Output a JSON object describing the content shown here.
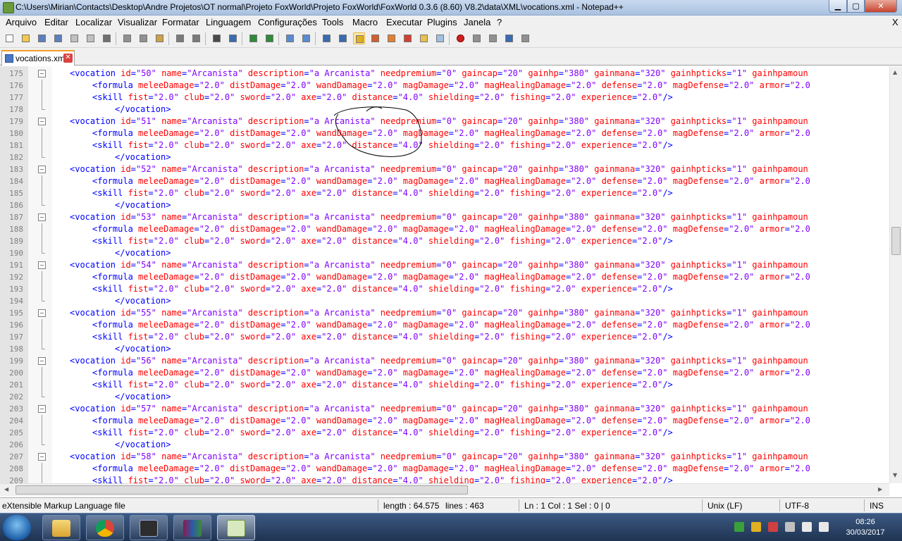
{
  "window": {
    "title": "C:\\Users\\Mirian\\Contacts\\Desktop\\Andre Projetos\\OT normal\\Projeto FoxWorld\\Projeto FoxWorld\\FoxWorld 0.3.6 (8.60) V8.2\\data\\XML\\vocations.xml - Notepad++",
    "min_label": "▁",
    "max_label": "▢",
    "close_label": "✕"
  },
  "menu": {
    "items": [
      "Arquivo",
      "Editar",
      "Localizar",
      "Visualizar",
      "Formatar",
      "Linguagem",
      "Configurações",
      "Tools",
      "Macro",
      "Executar",
      "Plugins",
      "Janela",
      "?"
    ],
    "close_doc": "X"
  },
  "toolbar": {
    "icons": [
      "new-file-icon",
      "open-file-icon",
      "save-icon",
      "save-all-icon",
      "close-icon",
      "close-all-icon",
      "print-icon",
      "cut-icon",
      "copy-icon",
      "paste-icon",
      "undo-icon",
      "redo-icon",
      "find-icon",
      "replace-icon",
      "zoom-in-icon",
      "zoom-out-icon",
      "sync-vertical-icon",
      "sync-horizontal-icon",
      "word-wrap-icon",
      "show-all-chars-icon",
      "indent-guide-icon",
      "user-language-icon",
      "document-map-icon",
      "function-list-icon",
      "folder-workspace-icon",
      "monitoring-icon",
      "record-macro-icon",
      "stop-macro-icon",
      "play-macro-icon",
      "run-macro-multiple-icon",
      "save-macro-icon"
    ]
  },
  "tab": {
    "label": "vocations.xml",
    "close": "✕"
  },
  "editor": {
    "lines": [
      {
        "n": "175",
        "kind": "vocation",
        "id": "50"
      },
      {
        "n": "176",
        "kind": "formula"
      },
      {
        "n": "177",
        "kind": "skill"
      },
      {
        "n": "178",
        "kind": "end"
      },
      {
        "n": "179",
        "kind": "vocation",
        "id": "51"
      },
      {
        "n": "180",
        "kind": "formula"
      },
      {
        "n": "181",
        "kind": "skill"
      },
      {
        "n": "182",
        "kind": "end"
      },
      {
        "n": "183",
        "kind": "vocation",
        "id": "52"
      },
      {
        "n": "184",
        "kind": "formula"
      },
      {
        "n": "185",
        "kind": "skill"
      },
      {
        "n": "186",
        "kind": "end"
      },
      {
        "n": "187",
        "kind": "vocation",
        "id": "53"
      },
      {
        "n": "188",
        "kind": "formula"
      },
      {
        "n": "189",
        "kind": "skill"
      },
      {
        "n": "190",
        "kind": "end"
      },
      {
        "n": "191",
        "kind": "vocation",
        "id": "54"
      },
      {
        "n": "192",
        "kind": "formula"
      },
      {
        "n": "193",
        "kind": "skill"
      },
      {
        "n": "194",
        "kind": "end"
      },
      {
        "n": "195",
        "kind": "vocation",
        "id": "55"
      },
      {
        "n": "196",
        "kind": "formula"
      },
      {
        "n": "197",
        "kind": "skill"
      },
      {
        "n": "198",
        "kind": "end"
      },
      {
        "n": "199",
        "kind": "vocation",
        "id": "56"
      },
      {
        "n": "200",
        "kind": "formula"
      },
      {
        "n": "201",
        "kind": "skill"
      },
      {
        "n": "202",
        "kind": "end"
      },
      {
        "n": "203",
        "kind": "vocation",
        "id": "57"
      },
      {
        "n": "204",
        "kind": "formula"
      },
      {
        "n": "205",
        "kind": "skill"
      },
      {
        "n": "206",
        "kind": "end"
      },
      {
        "n": "207",
        "kind": "vocation",
        "id": "58"
      },
      {
        "n": "208",
        "kind": "formula"
      },
      {
        "n": "209",
        "kind": "skill"
      }
    ],
    "vocation_tokens": [
      [
        "tg",
        "<vocation"
      ],
      [
        "at",
        " id"
      ],
      [
        "tg",
        "="
      ],
      [
        "vl",
        "\"{id}\""
      ],
      [
        "at",
        " name"
      ],
      [
        "tg",
        "="
      ],
      [
        "vl",
        "\"Arcanista\""
      ],
      [
        "at",
        " description"
      ],
      [
        "tg",
        "="
      ],
      [
        "vl",
        "\"a Arcanista\""
      ],
      [
        "at",
        " needpremium"
      ],
      [
        "tg",
        "="
      ],
      [
        "vl",
        "\"0\""
      ],
      [
        "at",
        " gaincap"
      ],
      [
        "tg",
        "="
      ],
      [
        "vl",
        "\"20\""
      ],
      [
        "at",
        " gainhp"
      ],
      [
        "tg",
        "="
      ],
      [
        "vl",
        "\"380\""
      ],
      [
        "at",
        " gainmana"
      ],
      [
        "tg",
        "="
      ],
      [
        "vl",
        "\"320\""
      ],
      [
        "at",
        " gainhpticks"
      ],
      [
        "tg",
        "="
      ],
      [
        "vl",
        "\"1\""
      ],
      [
        "at",
        " gainhpamoun"
      ]
    ],
    "formula_tokens": [
      [
        "tg",
        "<formula"
      ],
      [
        "at",
        " meleeDamage"
      ],
      [
        "tg",
        "="
      ],
      [
        "vl",
        "\"2.0\""
      ],
      [
        "at",
        " distDamage"
      ],
      [
        "tg",
        "="
      ],
      [
        "vl",
        "\"2.0\""
      ],
      [
        "at",
        " wandDamage"
      ],
      [
        "tg",
        "="
      ],
      [
        "vl",
        "\"2.0\""
      ],
      [
        "at",
        " magDamage"
      ],
      [
        "tg",
        "="
      ],
      [
        "vl",
        "\"2.0\""
      ],
      [
        "at",
        " magHealingDamage"
      ],
      [
        "tg",
        "="
      ],
      [
        "vl",
        "\"2.0\""
      ],
      [
        "at",
        " defense"
      ],
      [
        "tg",
        "="
      ],
      [
        "vl",
        "\"2.0\""
      ],
      [
        "at",
        " magDefense"
      ],
      [
        "tg",
        "="
      ],
      [
        "vl",
        "\"2.0\""
      ],
      [
        "at",
        " armor"
      ],
      [
        "tg",
        "="
      ],
      [
        "vl",
        "\"2.0"
      ]
    ],
    "skill_tokens": [
      [
        "tg",
        "<skill"
      ],
      [
        "at",
        " fist"
      ],
      [
        "tg",
        "="
      ],
      [
        "vl",
        "\"2.0\""
      ],
      [
        "at",
        " club"
      ],
      [
        "tg",
        "="
      ],
      [
        "vl",
        "\"2.0\""
      ],
      [
        "at",
        " sword"
      ],
      [
        "tg",
        "="
      ],
      [
        "vl",
        "\"2.0\""
      ],
      [
        "at",
        " axe"
      ],
      [
        "tg",
        "="
      ],
      [
        "vl",
        "\"2.0\""
      ],
      [
        "at",
        " distance"
      ],
      [
        "tg",
        "="
      ],
      [
        "vl",
        "\"4.0\""
      ],
      [
        "at",
        " shielding"
      ],
      [
        "tg",
        "="
      ],
      [
        "vl",
        "\"2.0\""
      ],
      [
        "at",
        " fishing"
      ],
      [
        "tg",
        "="
      ],
      [
        "vl",
        "\"2.0\""
      ],
      [
        "at",
        " experience"
      ],
      [
        "tg",
        "="
      ],
      [
        "vl",
        "\"2.0\""
      ],
      [
        "tg",
        "/>"
      ]
    ],
    "end_tokens": [
      [
        "tg",
        "</vocation>"
      ]
    ],
    "colors": {
      "tag": "#0000ff",
      "attr": "#ff0000",
      "value": "#8000ff"
    }
  },
  "status": {
    "filetype": "eXtensible Markup Language file",
    "length": "length : 64.575",
    "lines": "lines : 463",
    "pos": "Ln : 1    Col : 1    Sel : 0 | 0",
    "eol": "Unix (LF)",
    "encoding": "UTF-8",
    "mode": "INS"
  },
  "taskbar": {
    "apps": [
      "explorer-icon",
      "chrome-icon",
      "server-console-icon",
      "winrar-icon",
      "notepadpp-icon"
    ],
    "time": "08:26",
    "date": "30/03/2017"
  }
}
